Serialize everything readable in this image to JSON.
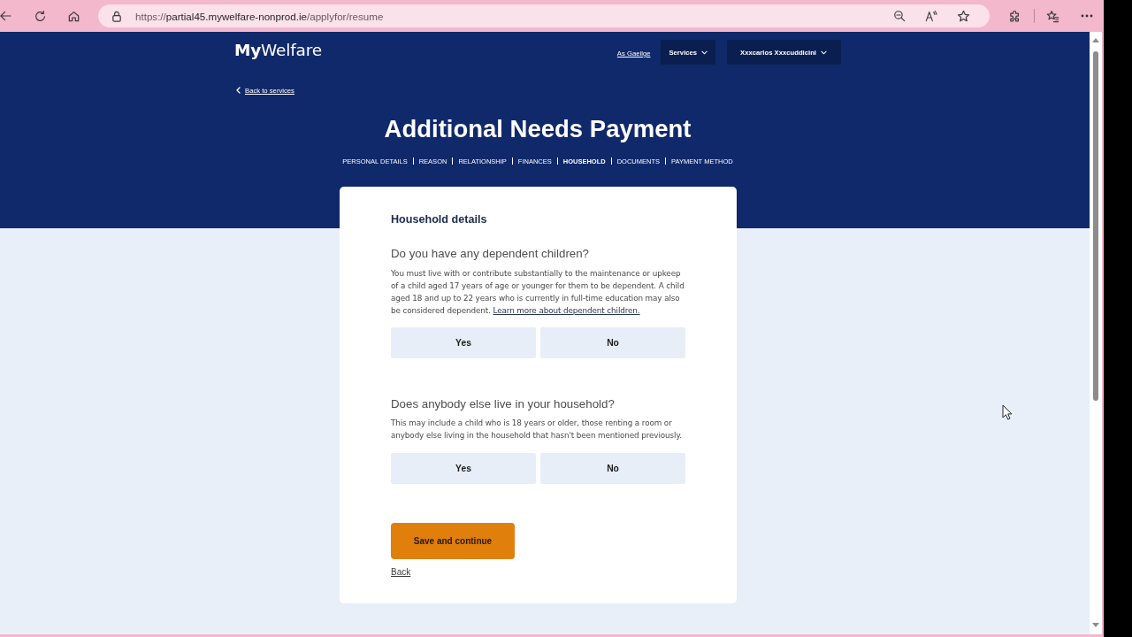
{
  "browser": {
    "url": {
      "scheme": "https://",
      "host": "partial45.mywelfare-nonprod.ie",
      "path": "/applyfor/resume"
    }
  },
  "header": {
    "logo": "**My**Welfare",
    "language_link": "As Gaeilge",
    "menus": [
      {
        "label": "Services"
      },
      {
        "label": "Xxxcarlos Xxxcuddicini"
      }
    ],
    "back_link": "Back to services",
    "title": "Additional Needs Payment",
    "steps": [
      {
        "label": "PERSONAL DETAILS",
        "selected": false
      },
      {
        "label": "REASON",
        "selected": false
      },
      {
        "label": "RELATIONSHIP",
        "selected": false
      },
      {
        "label": "FINANCES",
        "selected": false
      },
      {
        "label": "HOUSEHOLD",
        "selected": true
      },
      {
        "label": "DOCUMENTS",
        "selected": false
      },
      {
        "label": "PAYMENT METHOD",
        "selected": false
      }
    ]
  },
  "card": {
    "heading": "Household details",
    "questions": [
      {
        "question": "Do you have any dependent children?",
        "hint": "You must live with or contribute substantially to the maintenance or upkeep of a child aged 17 years of age or younger for them to be dependent. A child aged 18 and up to 22 years who is currently in full-time education may also be considered dependent.",
        "link": "Learn more about dependent children.",
        "options": [
          {
            "label": "Yes",
            "selected": false
          },
          {
            "label": "No",
            "selected": false
          }
        ]
      },
      {
        "question": "Does anybody else live in your household?",
        "hint": "This may include a child who is 18 years or older, those renting a room or anybody else living in the household that hasn't been mentioned previously.",
        "options": [
          {
            "label": "Yes",
            "selected": false
          },
          {
            "label": "No",
            "selected": false
          }
        ]
      }
    ],
    "primary_button": "Save and continue",
    "back_link": "Back"
  }
}
